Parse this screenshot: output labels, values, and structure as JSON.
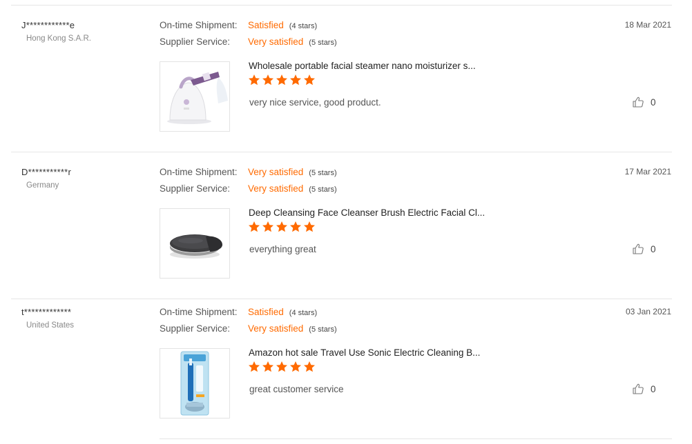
{
  "labels": {
    "ontime": "On-time Shipment:",
    "supplier": "Supplier Service:"
  },
  "colors": {
    "accent": "#ff6a00",
    "divider": "#e6e6e6",
    "star": "#ff6a00"
  },
  "reviews": [
    {
      "buyer": "J************e",
      "country": "Hong Kong S.A.R.",
      "date": "18 Mar 2021",
      "ontime_value": "Satisfied",
      "ontime_stars": "(4 stars)",
      "supplier_value": "Very satisfied",
      "supplier_stars": "(5 stars)",
      "product_title": "Wholesale portable facial steamer nano moisturizer s...",
      "product_image_icon": "facial-steamer",
      "rating": 5,
      "comment": "very nice service, good product.",
      "likes": "0"
    },
    {
      "buyer": "D***********r",
      "country": "Germany",
      "date": "17 Mar 2021",
      "ontime_value": "Very satisfied",
      "ontime_stars": "(5 stars)",
      "supplier_value": "Very satisfied",
      "supplier_stars": "(5 stars)",
      "product_title": "Deep Cleansing Face Cleanser Brush Electric Facial Cl...",
      "product_image_icon": "face-cleanser-brush",
      "rating": 5,
      "comment": "everything great",
      "likes": "0"
    },
    {
      "buyer": "t*************",
      "country": "United States",
      "date": "03 Jan 2021",
      "ontime_value": "Satisfied",
      "ontime_stars": "(4 stars)",
      "supplier_value": "Very satisfied",
      "supplier_stars": "(5 stars)",
      "product_title": "Amazon hot sale Travel Use Sonic Electric Cleaning B...",
      "product_image_icon": "electric-toothbrush-package",
      "rating": 5,
      "comment": "great customer service",
      "likes": "0"
    }
  ]
}
